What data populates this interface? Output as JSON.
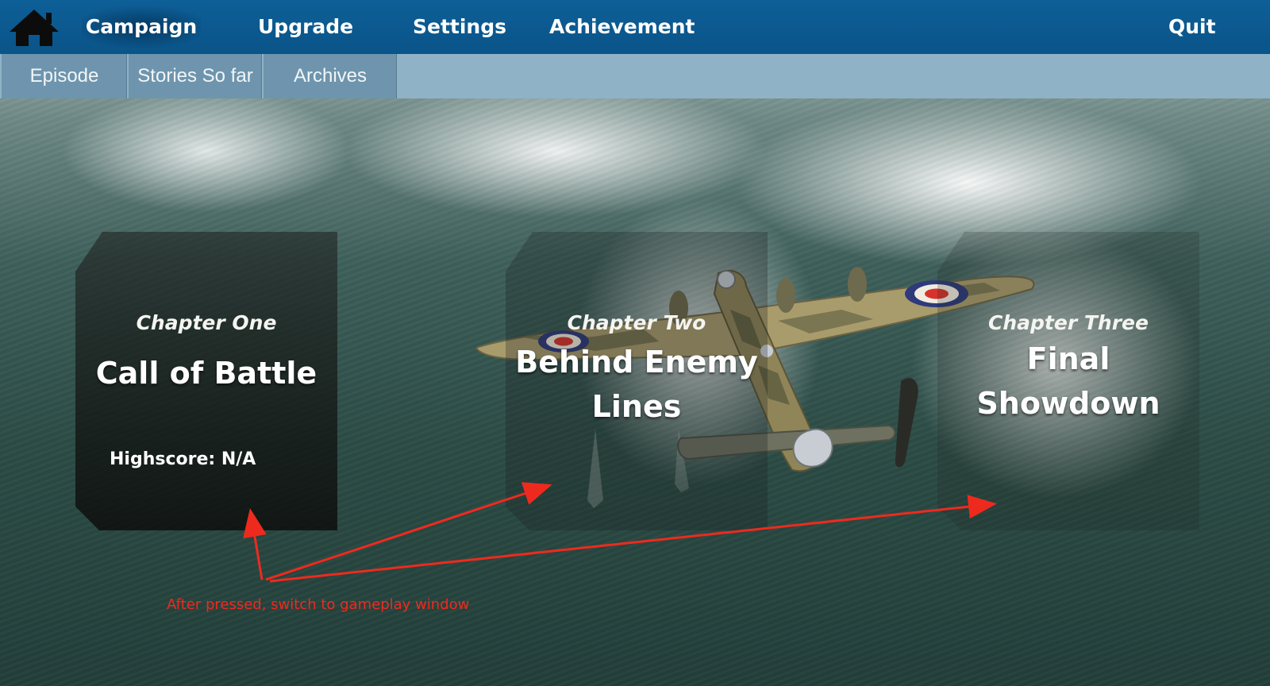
{
  "nav": {
    "home_icon": "home-icon",
    "items": [
      {
        "label": "Campaign",
        "active": true
      },
      {
        "label": "Upgrade",
        "active": false
      },
      {
        "label": "Settings",
        "active": false
      },
      {
        "label": "Achievement",
        "active": false
      }
    ],
    "quit_label": "Quit"
  },
  "subnav": {
    "tabs": [
      {
        "label": "Episode"
      },
      {
        "label": "Stories So far"
      },
      {
        "label": "Archives"
      }
    ]
  },
  "chapters": [
    {
      "label": "Chapter One",
      "title_lines": [
        "Call of Battle"
      ],
      "highscore": "Highscore: N/A"
    },
    {
      "label": "Chapter Two",
      "title_lines": [
        "Behind Enemy",
        "Lines"
      ]
    },
    {
      "label": "Chapter Three",
      "title_lines": [
        "Final",
        "Showdown"
      ]
    }
  ],
  "annotation": {
    "text": "After pressed, switch to gameplay window",
    "color": "#ee2a1e"
  },
  "colors": {
    "topbar": "#0d5f97",
    "subbar": "#8fb2c7",
    "subtab": "#6e95ad"
  }
}
